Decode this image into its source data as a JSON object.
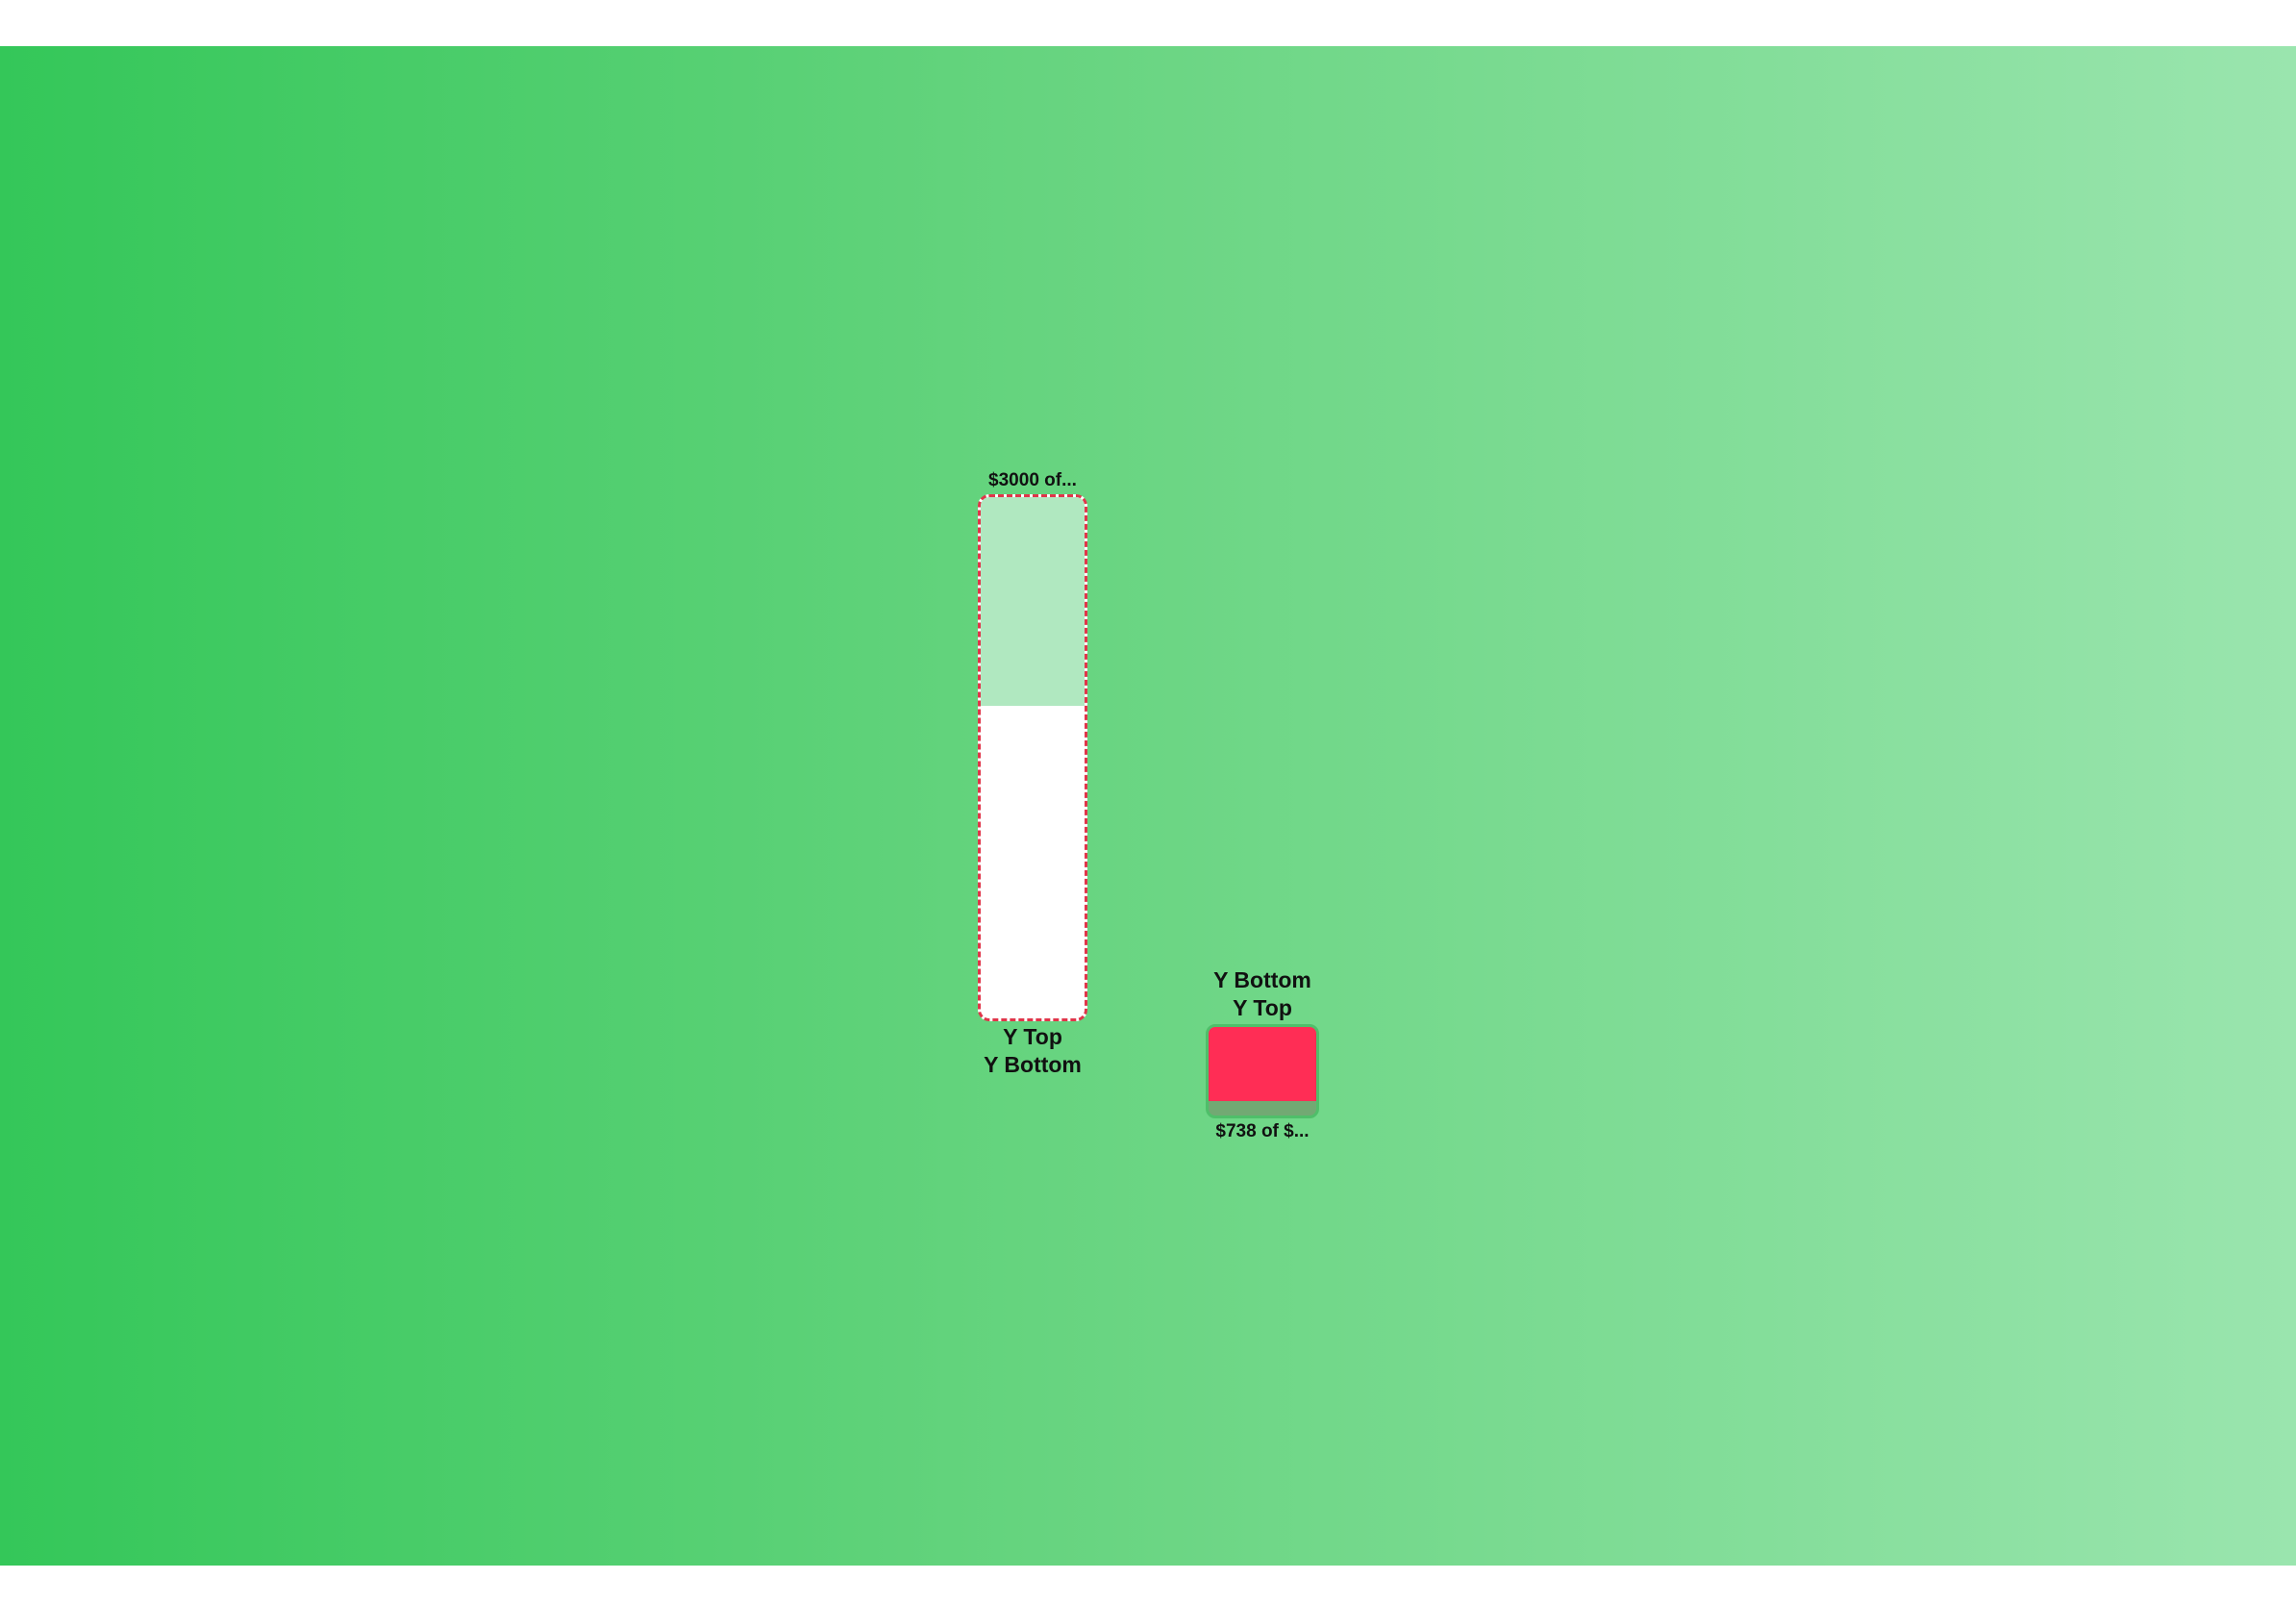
{
  "goals": [
    {
      "amount_text": "$3000 of...",
      "label_top": "Y Top",
      "label_bottom": "Y Bottom",
      "progress": 0.4,
      "fill_color": "#b0e8c0",
      "track_color": "#ffffff",
      "border_color": "#e0364a"
    },
    {
      "amount_text": "$738 of $...",
      "label_top": "Y Bottom",
      "label_bottom": "Y Top",
      "progress": 0.84,
      "fill_color": "#ff2d55",
      "track_color": "#72a973",
      "border_color": "#4fbf6a"
    }
  ],
  "background": {
    "gradient_start": "#34c759",
    "gradient_end": "#9ae5ae"
  }
}
